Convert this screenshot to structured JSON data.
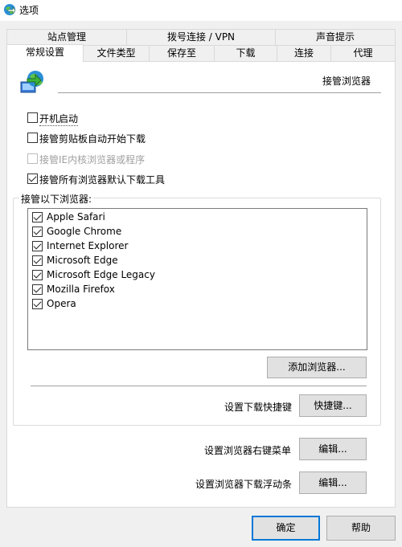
{
  "window": {
    "title": "选项"
  },
  "tabs_top": [
    "站点管理",
    "拨号连接 / VPN",
    "声音提示"
  ],
  "tabs_bottom": [
    "常规设置",
    "文件类型",
    "保存至",
    "下载",
    "连接",
    "代理"
  ],
  "section_title": "接管浏览器",
  "options": {
    "startup": {
      "label": "开机启动",
      "checked": false
    },
    "clipboard": {
      "label": "接管剪贴板自动开始下载",
      "checked": false
    },
    "ie_kernel": {
      "label": "接管IE内核浏览器或程序",
      "checked": false,
      "disabled": true
    },
    "default_tool": {
      "label": "接管所有浏览器默认下载工具",
      "checked": true
    }
  },
  "browsers_group": {
    "label": "接管以下浏览器:",
    "items": [
      {
        "label": "Apple Safari",
        "checked": true
      },
      {
        "label": "Google Chrome",
        "checked": true
      },
      {
        "label": "Internet Explorer",
        "checked": true
      },
      {
        "label": "Microsoft Edge",
        "checked": true
      },
      {
        "label": "Microsoft Edge Legacy",
        "checked": true
      },
      {
        "label": "Mozilla Firefox",
        "checked": true
      },
      {
        "label": "Opera",
        "checked": true
      }
    ],
    "add_button": "添加浏览器..."
  },
  "shortcut": {
    "label": "设置下载快捷键",
    "button": "快捷键..."
  },
  "context_menu": {
    "label": "设置浏览器右键菜单",
    "button": "编辑..."
  },
  "float_bar": {
    "label": "设置浏览器下载浮动条",
    "button": "编辑..."
  },
  "footer": {
    "ok": "确定",
    "help": "帮助"
  }
}
